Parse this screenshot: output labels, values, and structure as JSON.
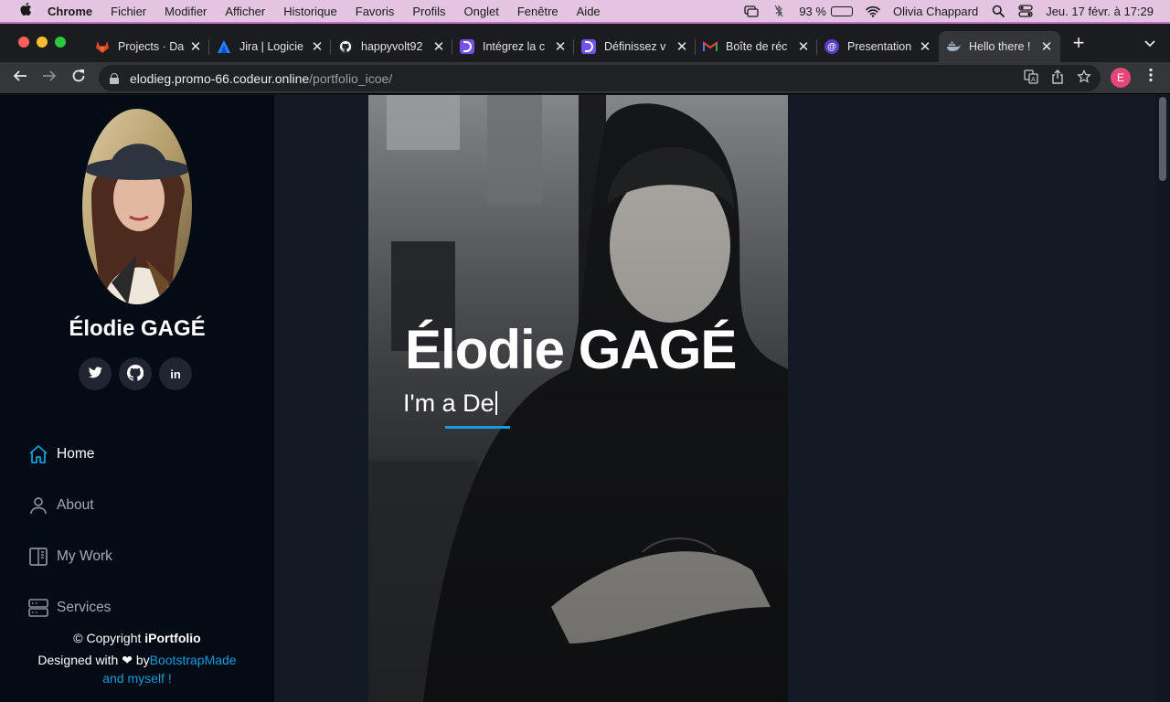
{
  "menubar": {
    "app": "Chrome",
    "items": [
      "Fichier",
      "Modifier",
      "Afficher",
      "Historique",
      "Favoris",
      "Profils",
      "Onglet",
      "Fenêtre",
      "Aide"
    ],
    "battery_percent": "93 %",
    "battery_level": 0.93,
    "user": "Olivia Chappard",
    "datetime": "Jeu. 17 févr. à  17:29",
    "icons": [
      "screen-mirroring-icon",
      "bluetooth-icon",
      "battery-icon",
      "wifi-icon",
      "search-icon",
      "control-center-icon"
    ]
  },
  "tabs": [
    {
      "title": "Projects · Da",
      "icon": "gitlab-icon",
      "color": "#e2432a"
    },
    {
      "title": "Jira | Logicie",
      "icon": "jira-icon",
      "color": "#2684ff"
    },
    {
      "title": "happyvolt92",
      "icon": "github-icon",
      "color": "#24292e"
    },
    {
      "title": "Intégrez la c",
      "icon": "openclassrooms-icon",
      "color": "#7451eb"
    },
    {
      "title": "Définissez v",
      "icon": "openclassrooms-icon",
      "color": "#7451eb"
    },
    {
      "title": "Boîte de réc",
      "icon": "gmail-icon",
      "color": "#ffffff"
    },
    {
      "title": "Presentation",
      "icon": "at-icon",
      "color": "#5b3cc4"
    },
    {
      "title": "Hello there !",
      "icon": "docker-icon",
      "color": "#35363a",
      "active": true
    }
  ],
  "address": {
    "host": "elodieg.promo-66.codeur.online",
    "path": "/portfolio_icoe/",
    "profile_initial": "E"
  },
  "sidebar": {
    "name": "Élodie GAGÉ",
    "socials": [
      {
        "label": "twitter",
        "icon": "twitter-icon"
      },
      {
        "label": "github",
        "icon": "github-icon"
      },
      {
        "label": "linkedin",
        "icon": "linkedin-icon",
        "glyph": "in"
      }
    ],
    "nav": [
      {
        "label": "Home",
        "icon": "home-icon",
        "active": true
      },
      {
        "label": "About",
        "icon": "person-icon"
      },
      {
        "label": "My Work",
        "icon": "book-icon"
      },
      {
        "label": "Services",
        "icon": "server-icon"
      }
    ],
    "footer": {
      "copyright": "© Copyright ",
      "brand": "iPortfolio",
      "designed": "Designed with ❤ by",
      "link": "BootstrapMade and myself !"
    }
  },
  "hero": {
    "title": "Élodie GAGÉ",
    "subtitle": "I'm a De"
  },
  "colors": {
    "accent": "#149ddd",
    "sidebar_bg": "#040b14",
    "page_bg": "#121a26"
  }
}
